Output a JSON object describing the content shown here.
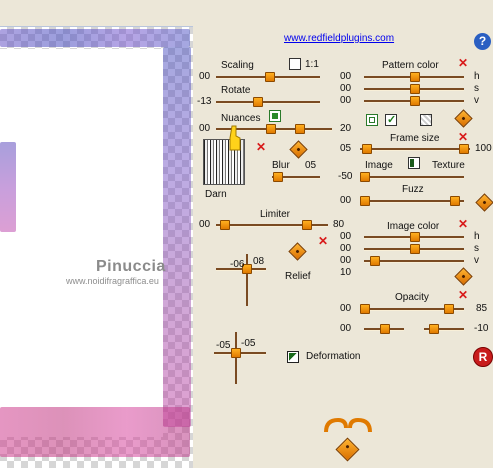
{
  "link": "www.redfieldplugins.com",
  "help_icon": "help-icon",
  "watermark": {
    "line1": "Pinuccia",
    "line2": "www.noidifragraffica.eu"
  },
  "scaling": {
    "label": "Scaling",
    "value": "00",
    "lock_label": "1:1"
  },
  "rotate": {
    "label": "Rotate",
    "value": "-13"
  },
  "nuances": {
    "label": "Nuances",
    "value_left": "00",
    "value_right": "20"
  },
  "texture_name": "Darn",
  "blur": {
    "label": "Blur",
    "value": "05"
  },
  "limiter": {
    "label": "Limiter",
    "value_left": "00",
    "value_right": "80"
  },
  "relief": {
    "label": "Relief",
    "x": "-06",
    "y": "08"
  },
  "deformation": {
    "label": "Deformation",
    "x": "-05",
    "y": "-05"
  },
  "pattern_color": {
    "label": "Pattern color",
    "h": "00",
    "s": "00",
    "v": "00",
    "h_label": "h",
    "s_label": "s",
    "v_label": "v"
  },
  "frame_size": {
    "label": "Frame size",
    "value_left": "05",
    "value_right": "100"
  },
  "image_texture": {
    "image_label": "Image",
    "texture_label": "Texture",
    "value": "-50"
  },
  "fuzz": {
    "label": "Fuzz",
    "value": "00"
  },
  "image_color": {
    "label": "Image color",
    "h": "00",
    "s": "00",
    "v": "00",
    "extra": "10",
    "h_label": "h",
    "s_label": "s",
    "v_label": "v"
  },
  "opacity": {
    "label": "Opacity",
    "value_left": "00",
    "value_right": "85",
    "row2_left": "00",
    "row2_right": "-10"
  },
  "reset_label": "R"
}
